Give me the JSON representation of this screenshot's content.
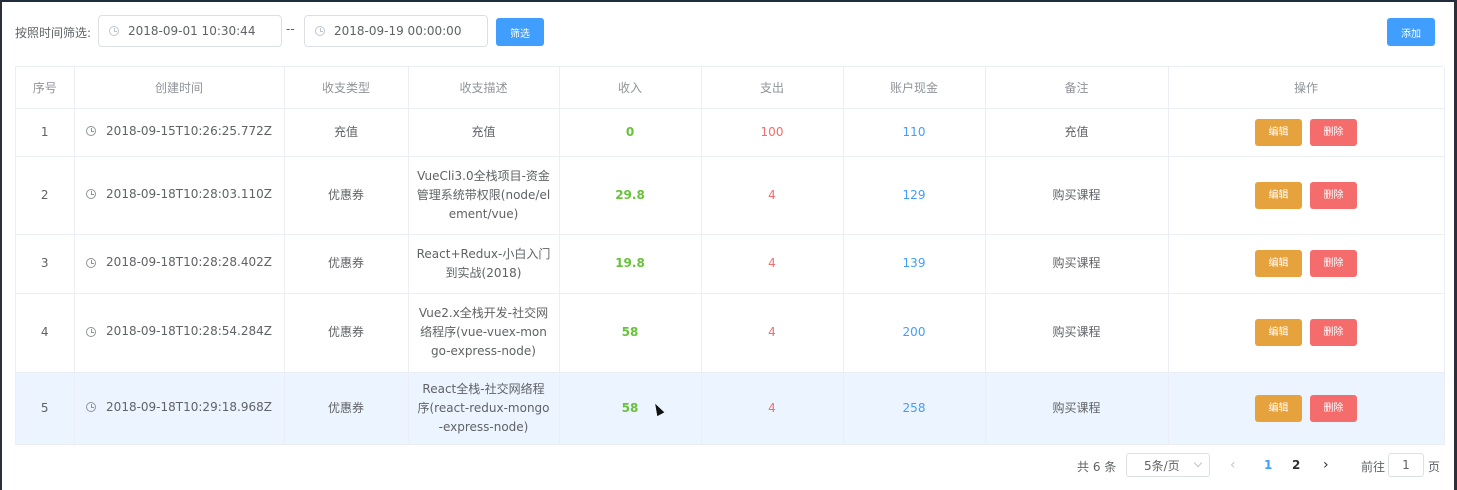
{
  "filter": {
    "label": "按照时间筛选:",
    "start": "2018-09-01 10:30:44",
    "separator": "--",
    "end": "2018-09-19 00:00:00",
    "button": "筛选"
  },
  "add_button": "添加",
  "table": {
    "headers": [
      "序号",
      "创建时间",
      "收支类型",
      "收支描述",
      "收入",
      "支出",
      "账户现金",
      "备注",
      "操作"
    ],
    "rows": [
      {
        "index": "1",
        "time": "2018-09-15T10:26:25.772Z",
        "type": "充值",
        "desc": "充值",
        "income": "0",
        "expense": "100",
        "cash": "110",
        "remark": "充值"
      },
      {
        "index": "2",
        "time": "2018-09-18T10:28:03.110Z",
        "type": "优惠券",
        "desc": "VueCli3.0全栈项目-资金管理系统带权限(node/element/vue)",
        "income": "29.8",
        "expense": "4",
        "cash": "129",
        "remark": "购买课程"
      },
      {
        "index": "3",
        "time": "2018-09-18T10:28:28.402Z",
        "type": "优惠券",
        "desc": "React+Redux-小白入门到实战(2018)",
        "income": "19.8",
        "expense": "4",
        "cash": "139",
        "remark": "购买课程"
      },
      {
        "index": "4",
        "time": "2018-09-18T10:28:54.284Z",
        "type": "优惠券",
        "desc": "Vue2.x全栈开发-社交网络程序(vue-vuex-mongo-express-node)",
        "income": "58",
        "expense": "4",
        "cash": "200",
        "remark": "购买课程"
      },
      {
        "index": "5",
        "time": "2018-09-18T10:29:18.968Z",
        "type": "优惠券",
        "desc": "React全栈-社交网络程序(react-redux-mongo-express-node)",
        "income": "58",
        "expense": "4",
        "cash": "258",
        "remark": "购买课程"
      }
    ],
    "edit_label": "编辑",
    "delete_label": "删除"
  },
  "pagination": {
    "total": "共 6 条",
    "page_size": "5条/页",
    "pages": [
      "1",
      "2"
    ],
    "current_page": "1",
    "goto_label": "前往",
    "goto_value": "1",
    "goto_suffix": "页"
  },
  "colors": {
    "primary": "#409eff",
    "warning": "#e6a23c",
    "danger": "#f56c6c",
    "success": "#67c23a",
    "highlight_row": "#ecf5ff"
  }
}
